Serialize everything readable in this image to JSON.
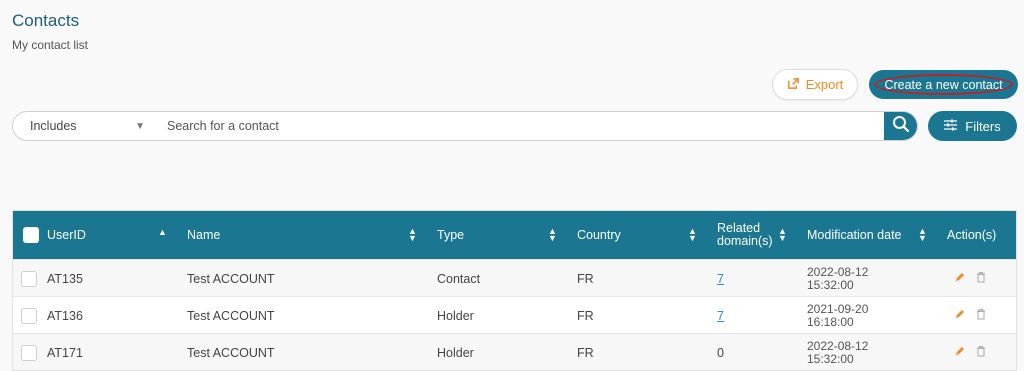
{
  "header": {
    "title": "Contacts",
    "subtitle": "My contact list"
  },
  "toolbar": {
    "export_label": "Export",
    "create_label": "Create a new contact"
  },
  "search": {
    "mode": "Includes",
    "placeholder": "Search for a contact",
    "filters_label": "Filters"
  },
  "colors": {
    "accent": "#1b7791",
    "export": "#f08a24",
    "link": "#2a8fc4",
    "highlight_ring": "#c0202a"
  },
  "table": {
    "columns": {
      "userid": "UserID",
      "name": "Name",
      "type": "Type",
      "country": "Country",
      "related1": "Related",
      "related2": "domain(s)",
      "modified": "Modification date",
      "actions": "Action(s)"
    },
    "rows": [
      {
        "userid": "AT135",
        "name": "Test ACCOUNT",
        "type": "Contact",
        "country": "FR",
        "domains": "7",
        "date": "2022-08-12",
        "time": "15:32:00"
      },
      {
        "userid": "AT136",
        "name": "Test ACCOUNT",
        "type": "Holder",
        "country": "FR",
        "domains": "7",
        "date": "2021-09-20",
        "time": "16:18:00"
      },
      {
        "userid": "AT171",
        "name": "Test ACCOUNT",
        "type": "Holder",
        "country": "FR",
        "domains": "0",
        "date": "2022-08-12",
        "time": "15:32:00"
      }
    ]
  },
  "icons": {
    "export": "export-icon",
    "search": "search-icon",
    "filters": "sliders-icon",
    "edit": "pencil-icon",
    "delete": "trash-icon"
  }
}
